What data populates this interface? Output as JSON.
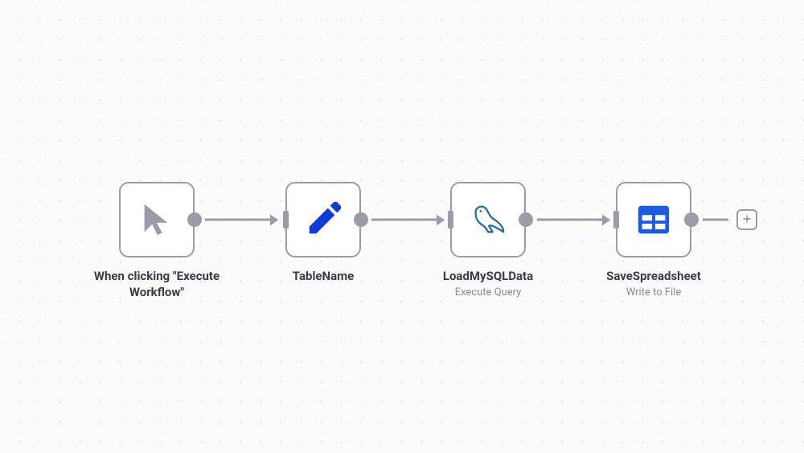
{
  "nodes": {
    "n1": {
      "title": "When clicking \"Execute Workflow\"",
      "subtitle": "",
      "icon": "cursor",
      "hasInput": false,
      "hasOutput": true
    },
    "n2": {
      "title": "TableName",
      "subtitle": "",
      "icon": "pencil",
      "hasInput": true,
      "hasOutput": true
    },
    "n3": {
      "title": "LoadMySQLData",
      "subtitle": "Execute Query",
      "icon": "mysql",
      "hasInput": true,
      "hasOutput": true
    },
    "n4": {
      "title": "SaveSpreadsheet",
      "subtitle": "Write to File",
      "icon": "spreadsheet",
      "hasInput": true,
      "hasOutput": true
    }
  },
  "icons": {
    "cursor_color": "#9c9ca7",
    "pencil_color": "#123ad6",
    "mysql_color": "#2a6f8e",
    "spreadsheet_color": "#1f5be0"
  }
}
